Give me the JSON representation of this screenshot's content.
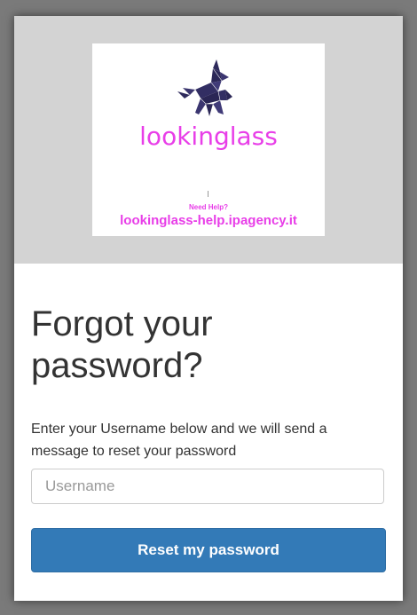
{
  "logo": {
    "brand_name": "lookinglass",
    "need_help": "Need Help?",
    "help_url": "lookinglass-help.ipagency.it",
    "icon": "unicorn-logo-icon",
    "brand_color": "#e83ee8"
  },
  "form": {
    "title": "Forgot your password?",
    "description": "Enter your Username below and we will send a message to reset your password",
    "username_placeholder": "Username",
    "username_value": "",
    "submit_label": "Reset my password"
  },
  "colors": {
    "banner_bg": "#d3d3d3",
    "button_bg": "#337ab7",
    "text": "#333333"
  }
}
